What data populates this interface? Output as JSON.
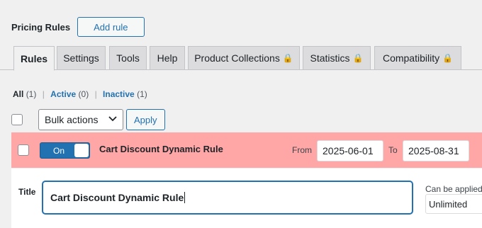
{
  "header": {
    "title": "Pricing Rules",
    "add_rule_label": "Add rule"
  },
  "tabs": [
    {
      "label": "Rules",
      "locked": false,
      "active": true
    },
    {
      "label": "Settings",
      "locked": false,
      "active": false
    },
    {
      "label": "Tools",
      "locked": false,
      "active": false
    },
    {
      "label": "Help",
      "locked": false,
      "active": false
    },
    {
      "label": "Product Collections",
      "locked": true,
      "active": false
    },
    {
      "label": "Statistics",
      "locked": true,
      "active": false
    },
    {
      "label": "Compatibility",
      "locked": true,
      "active": false
    }
  ],
  "lock_glyph": "🔒",
  "filters": {
    "all_label": "All",
    "all_count": "(1)",
    "active_label": "Active",
    "active_count": "(0)",
    "inactive_label": "Inactive",
    "inactive_count": "(1)",
    "separator": "|"
  },
  "bulk": {
    "selected": "Bulk actions",
    "apply_label": "Apply"
  },
  "rule": {
    "toggle_label": "On",
    "name": "Cart Discount Dynamic Rule",
    "from_label": "From",
    "from_date": "2025-06-01",
    "to_label": "To",
    "to_date": "2025-08-31",
    "highlight_color": "#ffa6a6"
  },
  "edit": {
    "title_label": "Title",
    "title_value": "Cart Discount Dynamic Rule",
    "applied_label": "Can be applied",
    "applied_value": "Unlimited"
  },
  "colors": {
    "accent": "#2271b1",
    "background": "#f0f0f1"
  }
}
